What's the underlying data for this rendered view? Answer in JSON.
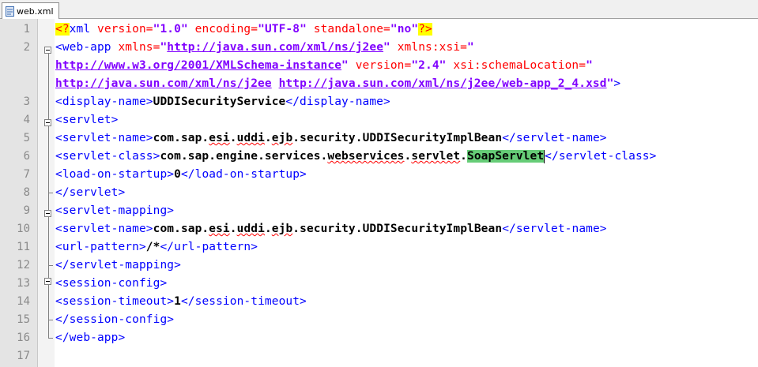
{
  "tab": {
    "label": "web.xml"
  },
  "lines": [
    {
      "n": "1"
    },
    {
      "n": "2"
    },
    {
      "n": ""
    },
    {
      "n": ""
    },
    {
      "n": "3"
    },
    {
      "n": "4"
    },
    {
      "n": "5"
    },
    {
      "n": "6"
    },
    {
      "n": "7"
    },
    {
      "n": "8"
    },
    {
      "n": "9"
    },
    {
      "n": "10"
    },
    {
      "n": "11"
    },
    {
      "n": "12"
    },
    {
      "n": "13"
    },
    {
      "n": "14"
    },
    {
      "n": "15"
    },
    {
      "n": "16"
    },
    {
      "n": "17"
    }
  ],
  "code": {
    "l1": {
      "pi_open": "<?",
      "tag": "xml",
      "a1": " version=",
      "v1": "\"1.0\"",
      "a2": " encoding=",
      "v2": "\"UTF-8\"",
      "a3": " standalone=",
      "v3": "\"no\"",
      "pi_close": "?>"
    },
    "l2": {
      "tag": "<web-app",
      "a1": " xmlns=",
      "v1q": "\"",
      "v1": "http://java.sun.com/xml/ns/j2ee",
      "v1e": "\"",
      "a2": " xmlns:xsi=",
      "v2q": "\""
    },
    "l2b": {
      "v1": "http://www.w3.org/2001/XMLSchema-instance",
      "v1e": "\"",
      "a1": " version=",
      "v2": "\"2.4\"",
      "a2": " xsi:schemaLocation=",
      "v3q": "\""
    },
    "l2c": {
      "v1": "http://java.sun.com/xml/ns/j2ee",
      "sp": " ",
      "v2": "http://java.sun.com/xml/ns/j2ee/web-app_2_4.xsd",
      "v2e": "\"",
      "tag": ">"
    },
    "l3": {
      "open": "<display-name>",
      "text": "UDDISecurityService",
      "close": "</display-name>"
    },
    "l4": {
      "tag": "<servlet>"
    },
    "l5": {
      "open": "<servlet-name>",
      "t1": "com.sap.",
      "w1": "esi",
      "t2": ".",
      "w2": "uddi",
      "t3": ".",
      "w3": "ejb",
      "t4": ".security.UDDISecurityImplBean",
      "close": "</servlet-name>"
    },
    "l6": {
      "open": "<servlet-class>",
      "t1": "com.sap.engine.services.",
      "w1": "webservices",
      "t2": ".",
      "w2": "servlet",
      "t3": ".",
      "hl": "SoapServlet",
      "close": "</servlet-class>"
    },
    "l7": {
      "open": "<load-on-startup>",
      "text": "0",
      "close": "</load-on-startup>"
    },
    "l8": {
      "tag": "</servlet>"
    },
    "l9": {
      "tag": "<servlet-mapping>"
    },
    "l10": {
      "open": "<servlet-name>",
      "t1": "com.sap.",
      "w1": "esi",
      "t2": ".",
      "w2": "uddi",
      "t3": ".",
      "w3": "ejb",
      "t4": ".security.UDDISecurityImplBean",
      "close": "</servlet-name>"
    },
    "l11": {
      "open": "<url-pattern>",
      "text": "/*",
      "close": "</url-pattern>"
    },
    "l12": {
      "tag": "</servlet-mapping>"
    },
    "l13": {
      "tag": "<session-config>"
    },
    "l14": {
      "open": "<session-timeout>",
      "text": "1",
      "close": "</session-timeout>"
    },
    "l15": {
      "tag": "</session-config>"
    },
    "l16": {
      "tag": "</web-app>"
    }
  }
}
